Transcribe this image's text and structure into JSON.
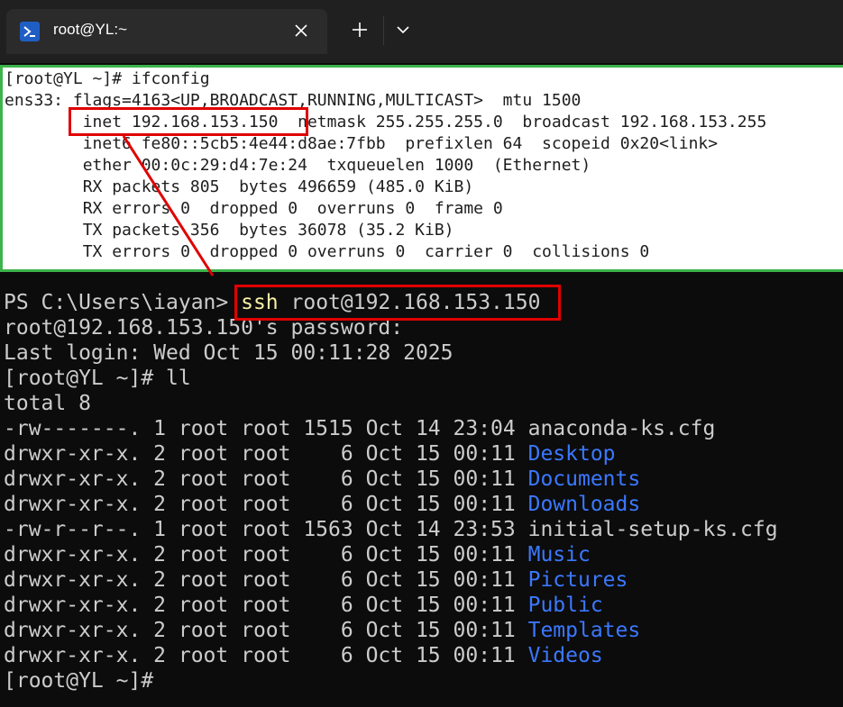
{
  "window": {
    "tab_title": "root@YL:~",
    "tab_icon": "powershell-icon",
    "close_icon": "close-icon",
    "new_tab_icon": "plus-icon",
    "dropdown_icon": "chevron-down-icon"
  },
  "inset": {
    "lines": [
      "[root@YL ~]# ifconfig",
      "ens33: flags=4163<UP,BROADCAST,RUNNING,MULTICAST>  mtu 1500",
      "        inet 192.168.153.150  netmask 255.255.255.0  broadcast 192.168.153.255",
      "        inet6 fe80::5cb5:4e44:d8ae:7fbb  prefixlen 64  scopeid 0x20<link>",
      "        ether 00:0c:29:d4:7e:24  txqueuelen 1000  (Ethernet)",
      "        RX packets 805  bytes 496659 (485.0 KiB)",
      "        RX errors 0  dropped 0  overruns 0  frame 0",
      "        TX packets 356  bytes 36078 (35.2 KiB)",
      "        TX errors 0  dropped 0 overruns 0  carrier 0  collisions 0"
    ]
  },
  "terminal": {
    "ps_prompt": "PS C:\\Users\\iayan> ",
    "ssh_cmd_word": "ssh",
    "ssh_cmd_args": " root@192.168.153.150",
    "password_prompt": "root@192.168.153.150's password:",
    "last_login": "Last login: Wed Oct 15 00:11:28 2025",
    "ll_prompt": "[root@YL ~]# ll",
    "total": "total 8",
    "listing": [
      {
        "meta": "-rw-------. 1 root root 1515 Oct 14 23:04 ",
        "name": "anaconda-ks.cfg",
        "is_dir": false
      },
      {
        "meta": "drwxr-xr-x. 2 root root    6 Oct 15 00:11 ",
        "name": "Desktop",
        "is_dir": true
      },
      {
        "meta": "drwxr-xr-x. 2 root root    6 Oct 15 00:11 ",
        "name": "Documents",
        "is_dir": true
      },
      {
        "meta": "drwxr-xr-x. 2 root root    6 Oct 15 00:11 ",
        "name": "Downloads",
        "is_dir": true
      },
      {
        "meta": "-rw-r--r--. 1 root root 1563 Oct 14 23:53 ",
        "name": "initial-setup-ks.cfg",
        "is_dir": false
      },
      {
        "meta": "drwxr-xr-x. 2 root root    6 Oct 15 00:11 ",
        "name": "Music",
        "is_dir": true
      },
      {
        "meta": "drwxr-xr-x. 2 root root    6 Oct 15 00:11 ",
        "name": "Pictures",
        "is_dir": true
      },
      {
        "meta": "drwxr-xr-x. 2 root root    6 Oct 15 00:11 ",
        "name": "Public",
        "is_dir": true
      },
      {
        "meta": "drwxr-xr-x. 2 root root    6 Oct 15 00:11 ",
        "name": "Templates",
        "is_dir": true
      },
      {
        "meta": "drwxr-xr-x. 2 root root    6 Oct 15 00:11 ",
        "name": "Videos",
        "is_dir": true
      }
    ],
    "final_prompt": "[root@YL ~]#"
  },
  "colors": {
    "terminal_bg": "#0c0c0c",
    "terminal_text": "#cccccc",
    "command_yellow": "#f9f1a5",
    "directory_blue": "#3b78ff",
    "annotation_red": "#e00000",
    "inset_border_green": "#3cb44b"
  }
}
